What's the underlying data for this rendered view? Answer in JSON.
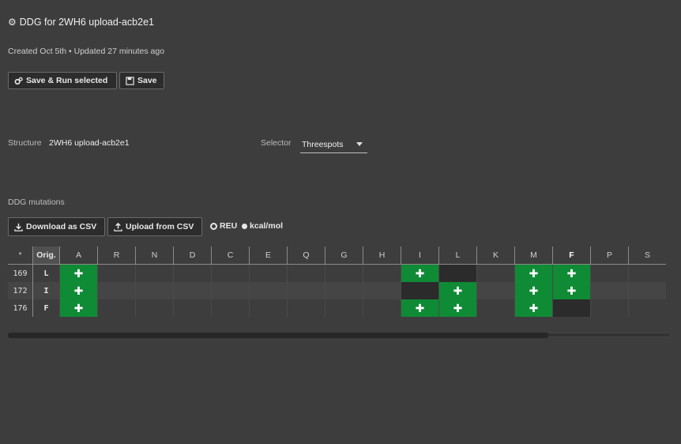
{
  "header": {
    "title": "DDG for 2WH6 upload-acb2e1",
    "meta": "Created Oct 5th • Updated 27 minutes ago"
  },
  "toolbar": {
    "save_run_label": "Save & Run selected",
    "save_label": "Save"
  },
  "structure": {
    "label": "Structure",
    "value": "2WH6 upload-acb2e1"
  },
  "selector": {
    "label": "Selector",
    "value": "Threespots"
  },
  "mutations": {
    "section_label": "DDG mutations",
    "download_label": "Download as CSV",
    "upload_label": "Upload from CSV",
    "unit_options": [
      {
        "label": "REU",
        "selected": true
      },
      {
        "label": "kcal/mol",
        "selected": false
      }
    ],
    "columns": {
      "star": "*",
      "orig": "Orig.",
      "aa": [
        "A",
        "R",
        "N",
        "D",
        "C",
        "E",
        "Q",
        "G",
        "H",
        "I",
        "L",
        "K",
        "M",
        "F",
        "P",
        "S"
      ]
    },
    "rows": [
      {
        "pos": "169",
        "orig": "L",
        "cells": [
          "+",
          "",
          "",
          "",
          "",
          "",
          "",
          "",
          "",
          "+",
          "x",
          "",
          "+",
          "+",
          "",
          ""
        ]
      },
      {
        "pos": "172",
        "orig": "I",
        "cells": [
          "+",
          "",
          "",
          "",
          "",
          "",
          "",
          "",
          "",
          "x",
          "+",
          "",
          "+",
          "+",
          "",
          ""
        ]
      },
      {
        "pos": "176",
        "orig": "F",
        "cells": [
          "+",
          "",
          "",
          "",
          "",
          "",
          "",
          "",
          "",
          "+",
          "+",
          "",
          "+",
          "x",
          "",
          ""
        ]
      }
    ]
  },
  "colors": {
    "background": "#3d3d3d",
    "selected_cell": "#0f8a35",
    "original_cell": "#2b2b2b"
  }
}
